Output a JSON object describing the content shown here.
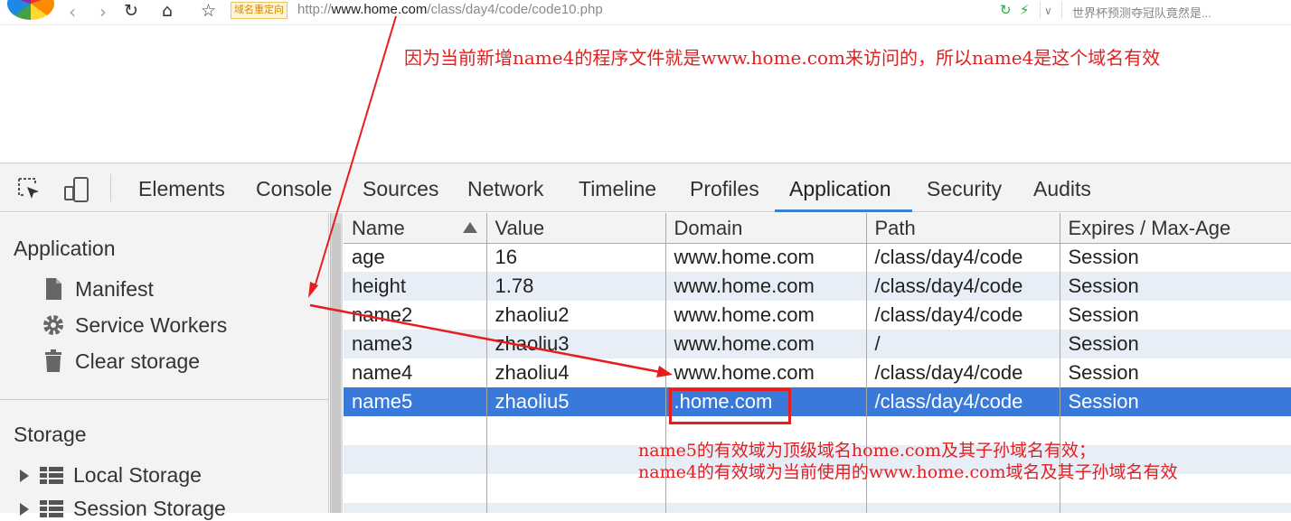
{
  "browser": {
    "redirect_tag": "域名重定向",
    "url_prefix": "http://",
    "url_domain": "www.home.com",
    "url_path": "/class/day4/code/code10.php",
    "search_hint": "世界杯预测夺冠队竟然是..."
  },
  "annotations": {
    "top_note": "因为当前新增name4的程序文件就是www.home.com来访问的，所以name4是这个域名有效",
    "bottom_note_1": "name5的有效域为顶级域名home.com及其子孙域名有效；",
    "bottom_note_2": "name4的有效域为当前使用的www.home.com域名及其子孙域名有效",
    "arrow_color": "#e81c1c"
  },
  "devtools": {
    "tabs": [
      "Elements",
      "Console",
      "Sources",
      "Network",
      "Timeline",
      "Profiles",
      "Application",
      "Security",
      "Audits"
    ],
    "active_tab": "Application",
    "sidebar": {
      "application_header": "Application",
      "items": [
        "Manifest",
        "Service Workers",
        "Clear storage"
      ],
      "storage_header": "Storage",
      "storage_items": [
        "Local Storage",
        "Session Storage"
      ]
    },
    "table": {
      "columns": [
        "Name",
        "Value",
        "Domain",
        "Path",
        "Expires / Max-Age"
      ],
      "sorted_column": "Name",
      "sort_direction": "ascending",
      "rows": [
        [
          "age",
          "16",
          "www.home.com",
          "/class/day4/code",
          "Session"
        ],
        [
          "height",
          "1.78",
          "www.home.com",
          "/class/day4/code",
          "Session"
        ],
        [
          "name2",
          "zhaoliu2",
          "www.home.com",
          "/class/day4/code",
          "Session"
        ],
        [
          "name3",
          "zhaoliu3",
          "www.home.com",
          "/",
          "Session"
        ],
        [
          "name4",
          "zhaoliu4",
          "www.home.com",
          "/class/day4/code",
          "Session"
        ],
        [
          "name5",
          "zhaoliu5",
          ".home.com",
          "/class/day4/code",
          "Session"
        ]
      ],
      "selected_row": "name5",
      "selection_color": "#3879d9",
      "stripe_color": "#e8eef8"
    }
  }
}
